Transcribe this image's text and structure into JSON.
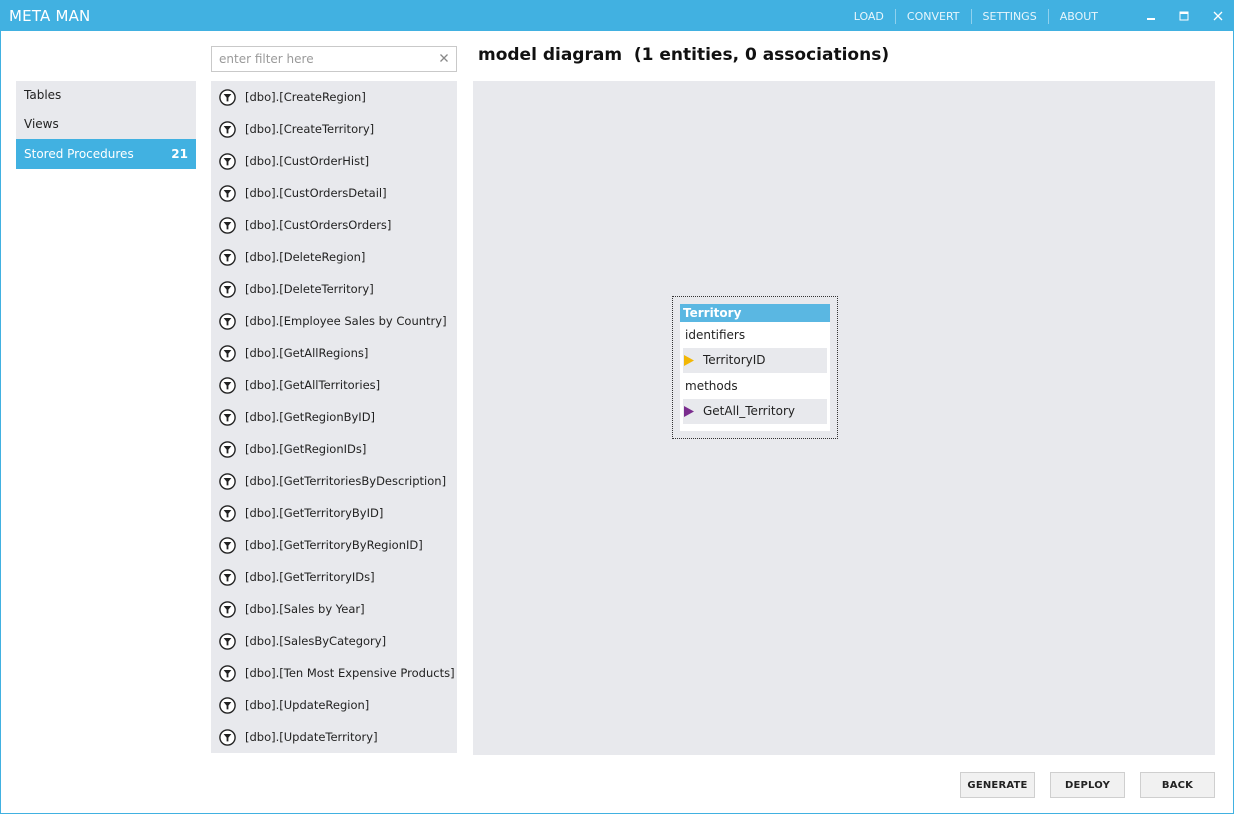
{
  "app": {
    "title": "META MAN",
    "menu": [
      "LOAD",
      "CONVERT",
      "SETTINGS",
      "ABOUT"
    ],
    "accent_color": "#41b1e1"
  },
  "nav": {
    "items": [
      {
        "label": "Tables",
        "badge": ""
      },
      {
        "label": "Views",
        "badge": ""
      },
      {
        "label": "Stored Procedures",
        "badge": "21"
      }
    ],
    "active": "Stored Procedures"
  },
  "filter": {
    "placeholder": "enter filter here",
    "value": "",
    "clear_icon": "close-icon"
  },
  "procedures": [
    "[dbo].[CreateRegion]",
    "[dbo].[CreateTerritory]",
    "[dbo].[CustOrderHist]",
    "[dbo].[CustOrdersDetail]",
    "[dbo].[CustOrdersOrders]",
    "[dbo].[DeleteRegion]",
    "[dbo].[DeleteTerritory]",
    "[dbo].[Employee Sales by Country]",
    "[dbo].[GetAllRegions]",
    "[dbo].[GetAllTerritories]",
    "[dbo].[GetRegionByID]",
    "[dbo].[GetRegionIDs]",
    "[dbo].[GetTerritoriesByDescription]",
    "[dbo].[GetTerritoryByID]",
    "[dbo].[GetTerritoryByRegionID]",
    "[dbo].[GetTerritoryIDs]",
    "[dbo].[Sales by Year]",
    "[dbo].[SalesByCategory]",
    "[dbo].[Ten Most Expensive Products]",
    "[dbo].[UpdateRegion]",
    "[dbo].[UpdateTerritory]"
  ],
  "procedure_icon": "filter-funnel-icon",
  "diagram": {
    "title": "model diagram  (1 entities, 0 associations)",
    "entity": {
      "name": "Territory",
      "identifiers_label": "identifiers",
      "identifier": "TerritoryID",
      "methods_label": "methods",
      "method": "GetAll_Territory",
      "identifier_marker_color": "#f2b705",
      "method_marker_color": "#7b2d8e"
    }
  },
  "buttons": {
    "generate": "GENERATE",
    "deploy": "DEPLOY",
    "back": "BACK"
  }
}
